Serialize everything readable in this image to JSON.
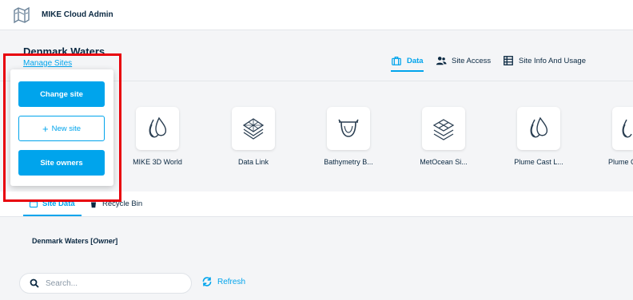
{
  "topbar": {
    "app_title": "MIKE Cloud Admin",
    "logo_icon": "map-folded-icon"
  },
  "header": {
    "site_title": "Denmark Waters",
    "manage_link": "Manage Sites",
    "tabs": [
      {
        "label": "Data",
        "icon": "briefcase-icon",
        "active": true
      },
      {
        "label": "Site Access",
        "icon": "users-icon",
        "active": false
      },
      {
        "label": "Site Info And Usage",
        "icon": "table-icon",
        "active": false
      }
    ]
  },
  "apps": [
    {
      "label": "MIKE 3D World",
      "icon": "waterdrops-icon"
    },
    {
      "label": "Data Link",
      "icon": "layers-icon"
    },
    {
      "label": "Bathymetry B...",
      "icon": "bathymetry-icon"
    },
    {
      "label": "MetOcean Si...",
      "icon": "metocean-icon"
    },
    {
      "label": "Plume Cast L...",
      "icon": "waterdrops-icon"
    },
    {
      "label": "Plume C",
      "icon": "waterdrops-icon"
    }
  ],
  "popup": {
    "change_site": "Change site",
    "new_site": "New site",
    "site_owners": "Site owners"
  },
  "subtabs": [
    {
      "label": "Site Data",
      "active": true
    },
    {
      "label": "Recycle Bin",
      "active": false
    }
  ],
  "content": {
    "owner_name": "Denmark Waters",
    "owner_role": "Owner",
    "search_placeholder": "Search...",
    "refresh_label": "Refresh"
  },
  "colors": {
    "accent": "#00a4ec",
    "text": "#0b2942",
    "highlight": "#e8000b",
    "background": "#f4f5f7"
  }
}
